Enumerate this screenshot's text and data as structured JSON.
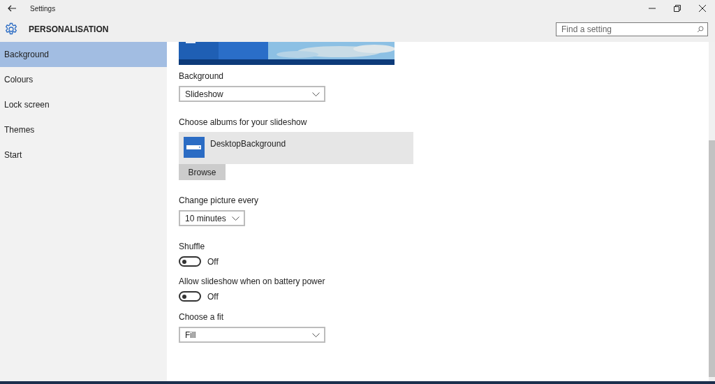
{
  "window": {
    "title": "Settings"
  },
  "header": {
    "title": "PERSONALISATION",
    "search": {
      "placeholder": "Find a setting"
    }
  },
  "sidebar": {
    "items": [
      {
        "label": "Background",
        "selected": true
      },
      {
        "label": "Colours",
        "selected": false
      },
      {
        "label": "Lock screen",
        "selected": false
      },
      {
        "label": "Themes",
        "selected": false
      },
      {
        "label": "Start",
        "selected": false
      }
    ]
  },
  "content": [
    {
      "kind": "picture"
    },
    {
      "kind": "dropdown",
      "label": "Background",
      "value": "Slideshow"
    },
    {
      "kind": "albums",
      "label": "Choose albums for your slideshow",
      "albums": [
        "DesktopBackground"
      ],
      "button": "Browse"
    },
    {
      "kind": "compact-dropdown",
      "label": "Change picture every",
      "value": "10 minutes"
    },
    {
      "kind": "toggle",
      "label": "Shuffle",
      "on": false,
      "state": "Off"
    },
    {
      "kind": "toggle",
      "label": "Allow slideshow when on battery power",
      "on": false,
      "state": "Off"
    },
    {
      "kind": "dropdown",
      "label": "Choose a fit",
      "value": "Fill"
    }
  ]
}
